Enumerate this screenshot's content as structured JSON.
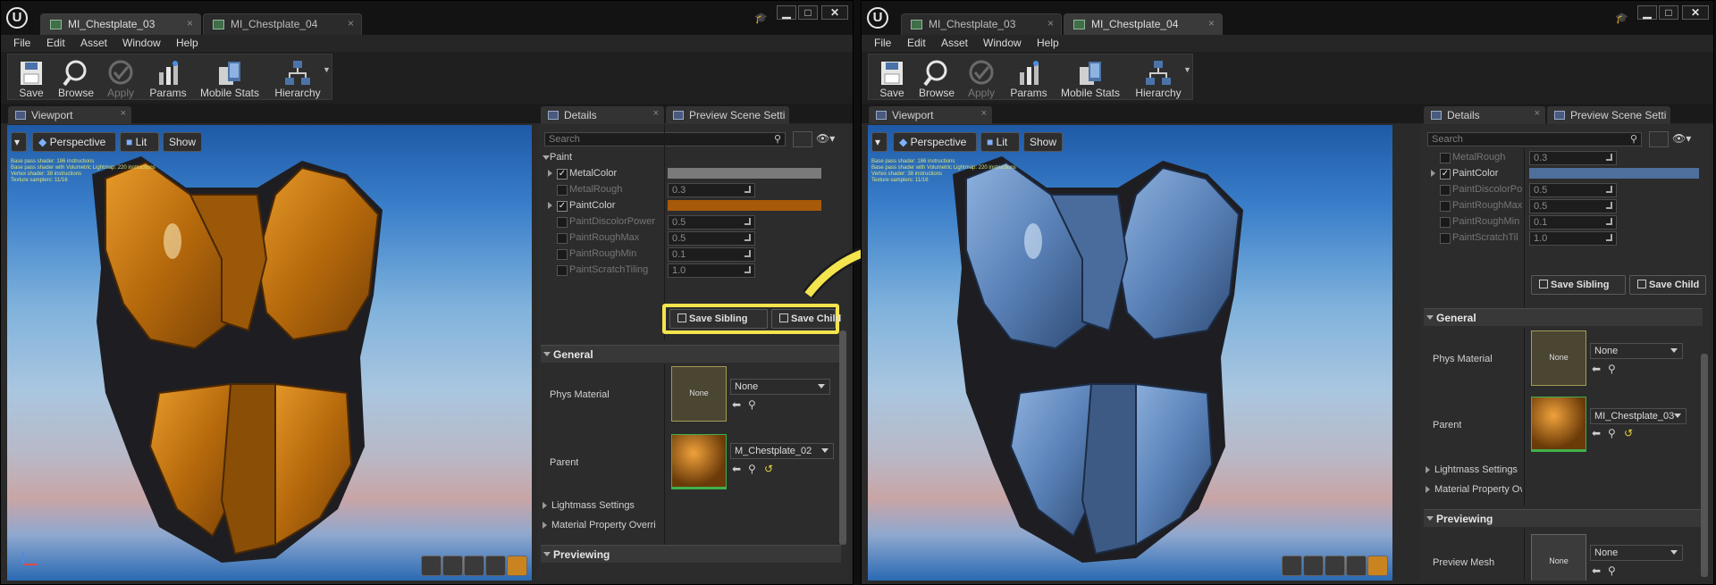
{
  "windows": [
    {
      "id": "left",
      "tabs": [
        {
          "label": "MI_Chestplate_03",
          "active": true
        },
        {
          "label": "MI_Chestplate_04",
          "active": false
        }
      ],
      "menu": [
        "File",
        "Edit",
        "Asset",
        "Window",
        "Help"
      ],
      "toolbar": [
        {
          "label": "Save",
          "icon": "save-icon",
          "enabled": true
        },
        {
          "label": "Browse",
          "icon": "browse-icon",
          "enabled": true
        },
        {
          "label": "Apply",
          "icon": "apply-icon",
          "enabled": false
        },
        {
          "label": "Params",
          "icon": "params-icon",
          "enabled": true
        },
        {
          "label": "Mobile Stats",
          "icon": "mobile-stats-icon",
          "enabled": true
        },
        {
          "label": "Hierarchy",
          "icon": "hierarchy-icon",
          "enabled": true
        }
      ],
      "viewport_tab": "Viewport",
      "details_tab": "Details",
      "preview_tab": "Preview Scene Setti",
      "viewport_buttons": [
        "Perspective",
        "Lit",
        "Show"
      ],
      "stats": [
        "Base pass shader: 186 instructions",
        "Base pass shader with Volumetric Lightmap: 220 instructions",
        "Vertex shader: 38 instructions",
        "Texture samplers: 11/16"
      ],
      "search_placeholder": "Search",
      "paint_section": "Paint",
      "params": [
        {
          "label": "MetalColor",
          "checked": true,
          "type": "color",
          "color": "#7a7a7a"
        },
        {
          "label": "MetalRough",
          "checked": false,
          "type": "number",
          "value": "0.3"
        },
        {
          "label": "PaintColor",
          "checked": true,
          "type": "color",
          "color": "#a65a0a"
        },
        {
          "label": "PaintDiscolorPower",
          "checked": false,
          "type": "number",
          "value": "0.5"
        },
        {
          "label": "PaintRoughMax",
          "checked": false,
          "type": "number",
          "value": "0.5"
        },
        {
          "label": "PaintRoughMin",
          "checked": false,
          "type": "number",
          "value": "0.1"
        },
        {
          "label": "PaintScratchTiling",
          "checked": false,
          "type": "number",
          "value": "1.0"
        }
      ],
      "save_sibling": "Save Sibling",
      "save_child": "Save Child",
      "general_section": "General",
      "phys_material_label": "Phys Material",
      "phys_material_thumb": "None",
      "phys_material_value": "None",
      "parent_label": "Parent",
      "parent_value": "M_Chestplate_02",
      "lightmass": "Lightmass Settings",
      "material_property": "Material Property Overri",
      "previewing_section": "Previewing",
      "armor_color": "#c9770f"
    },
    {
      "id": "right",
      "tabs": [
        {
          "label": "MI_Chestplate_03",
          "active": false
        },
        {
          "label": "MI_Chestplate_04",
          "active": true
        }
      ],
      "menu": [
        "File",
        "Edit",
        "Asset",
        "Window",
        "Help"
      ],
      "toolbar": [
        {
          "label": "Save",
          "icon": "save-icon",
          "enabled": true
        },
        {
          "label": "Browse",
          "icon": "browse-icon",
          "enabled": true
        },
        {
          "label": "Apply",
          "icon": "apply-icon",
          "enabled": false
        },
        {
          "label": "Params",
          "icon": "params-icon",
          "enabled": true
        },
        {
          "label": "Mobile Stats",
          "icon": "mobile-stats-icon",
          "enabled": true
        },
        {
          "label": "Hierarchy",
          "icon": "hierarchy-icon",
          "enabled": true
        }
      ],
      "viewport_tab": "Viewport",
      "details_tab": "Details",
      "preview_tab": "Preview Scene Setti",
      "viewport_buttons": [
        "Perspective",
        "Lit",
        "Show"
      ],
      "stats": [
        "Base pass shader: 186 instructions",
        "Base pass shader with Volumetric Lightmap: 220 instructions",
        "Vertex shader: 38 instructions",
        "Texture samplers: 11/16"
      ],
      "search_placeholder": "Search",
      "params": [
        {
          "label": "MetalRough",
          "checked": false,
          "type": "number",
          "value": "0.3"
        },
        {
          "label": "PaintColor",
          "checked": true,
          "type": "color",
          "color": "#4f6f9c"
        },
        {
          "label": "PaintDiscolorPo",
          "checked": false,
          "type": "number",
          "value": "0.5"
        },
        {
          "label": "PaintRoughMax",
          "checked": false,
          "type": "number",
          "value": "0.5"
        },
        {
          "label": "PaintRoughMin",
          "checked": false,
          "type": "number",
          "value": "0.1"
        },
        {
          "label": "PaintScratchTil",
          "checked": false,
          "type": "number",
          "value": "1.0"
        }
      ],
      "save_sibling": "Save Sibling",
      "save_child": "Save Child",
      "general_section": "General",
      "phys_material_label": "Phys Material",
      "phys_material_thumb": "None",
      "phys_material_value": "None",
      "parent_label": "Parent",
      "parent_value": "MI_Chestplate_03",
      "lightmass": "Lightmass Settings",
      "material_property": "Material Property Ov",
      "previewing_section": "Previewing",
      "preview_mesh_label": "Preview Mesh",
      "preview_mesh_thumb": "None",
      "preview_mesh_value": "None",
      "armor_color": "#5a82b8"
    }
  ],
  "colors": {
    "highlight": "#f4e44e",
    "accent": "#4f6f9c"
  }
}
